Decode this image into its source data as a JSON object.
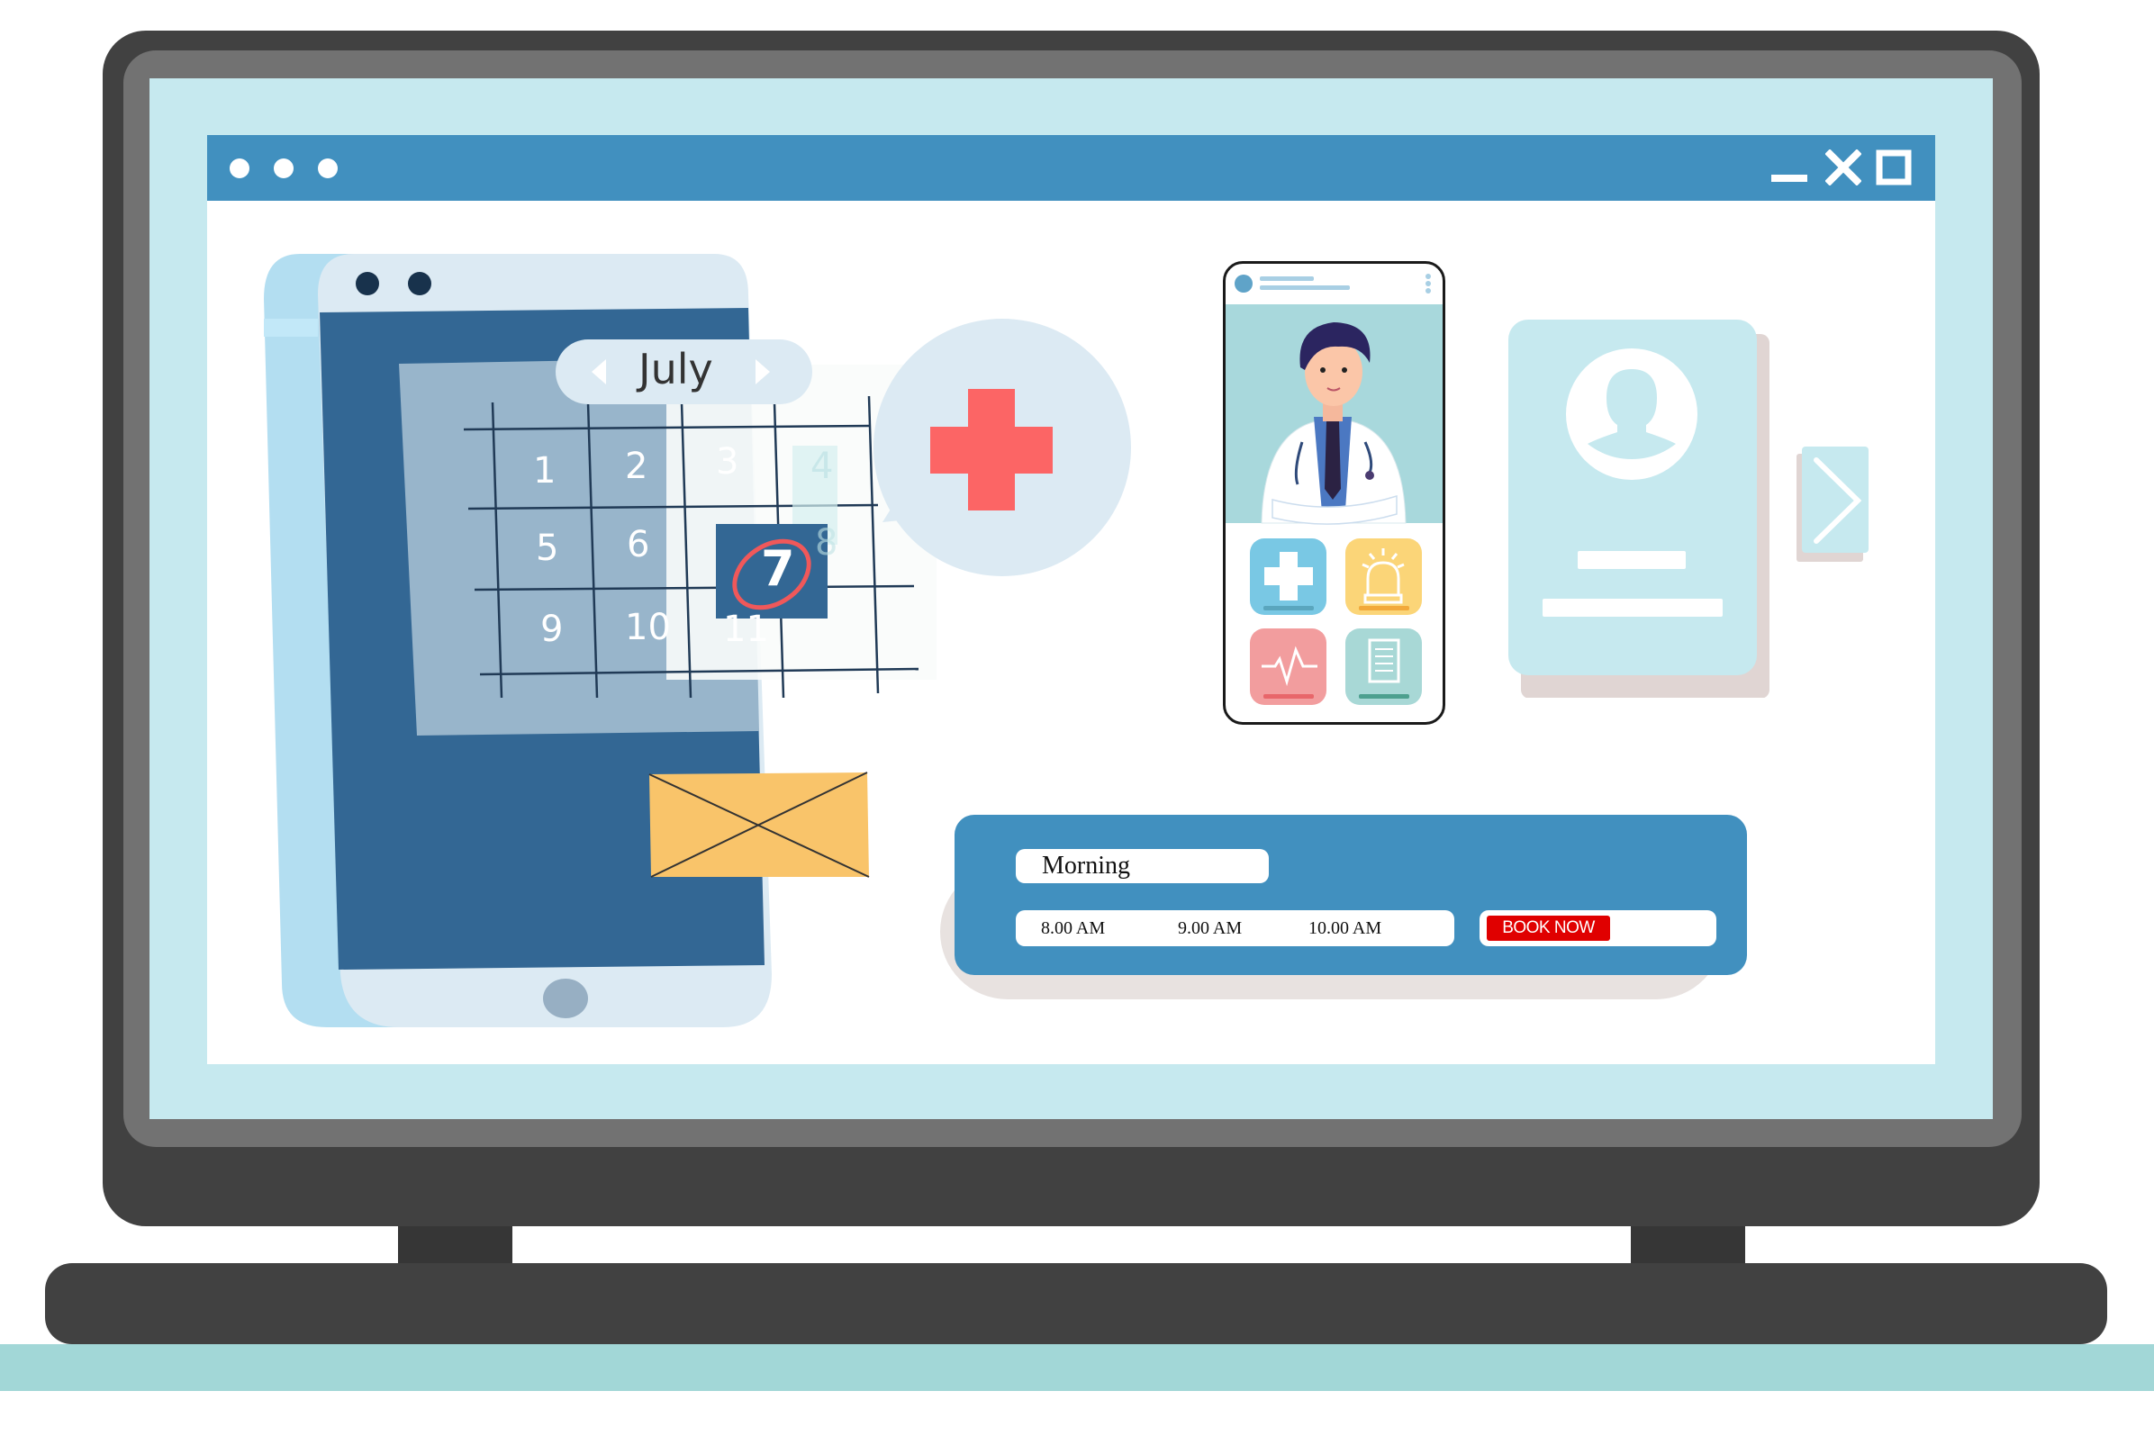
{
  "window": {
    "controls": [
      "minimize-icon",
      "close-icon",
      "maximize-icon"
    ],
    "traffic_dots": 3
  },
  "calendar": {
    "month": "July",
    "days": [
      "1",
      "2",
      "3",
      "4",
      "5",
      "6",
      "7",
      "8",
      "9",
      "10",
      "11"
    ],
    "selected_day": "7",
    "faded_days": [
      "4",
      "8"
    ]
  },
  "doctor_app": {
    "tiles": [
      {
        "icon": "medical-cross-icon",
        "color": "#79c8e4",
        "bar": "#5aa6be"
      },
      {
        "icon": "siren-alarm-icon",
        "color": "#fbd578",
        "bar": "#f2a93b"
      },
      {
        "icon": "heartbeat-icon",
        "color": "#f29d9e",
        "bar": "#e8666a"
      },
      {
        "icon": "document-icon",
        "color": "#a8d8d6",
        "bar": "#4da08f"
      }
    ]
  },
  "booking": {
    "period": "Morning",
    "times": [
      "8.00 AM",
      "9.00 AM",
      "10.00 AM"
    ],
    "book_label": "BOOK NOW"
  },
  "colors": {
    "accent": "#4190bf",
    "book_button": "#e00000",
    "medical_cross": "#fc6565",
    "tablet_screen": "#336794"
  }
}
